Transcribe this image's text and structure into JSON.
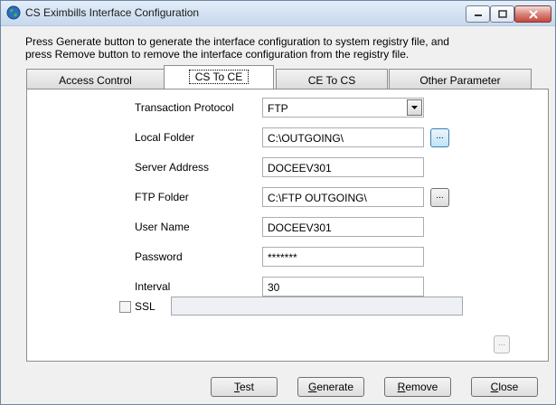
{
  "window": {
    "title": "CS Eximbills Interface Configuration",
    "icon": "globe-icon",
    "controls": [
      "minimize-icon",
      "maximize-icon",
      "close-icon"
    ]
  },
  "description": {
    "line1": "Press Generate button to generate the interface configuration to system registry file, and",
    "line2": "press Remove button to remove the interface configuration from the registry file."
  },
  "tabs": [
    {
      "label": "Access Control",
      "active": false
    },
    {
      "label": "CS To CE",
      "active": true
    },
    {
      "label": "CE To CS",
      "active": false
    },
    {
      "label": "Other Parameter",
      "active": false
    }
  ],
  "form": {
    "protocol_label": "Transaction Protocol",
    "protocol_value": "FTP",
    "local_folder_label": "Local Folder",
    "local_folder_value": "C:\\OUTGOING\\",
    "server_label": "Server Address",
    "server_value": "DOCEEV301",
    "ftp_folder_label": "FTP Folder",
    "ftp_folder_value": "C:\\FTP OUTGOING\\",
    "user_label": "User Name",
    "user_value": "DOCEEV301",
    "password_label": "Password",
    "password_value": "*******",
    "interval_label": "Interval",
    "interval_value": "30",
    "browse_label": "...",
    "ssl_label": "SSL",
    "ssl_checked": false,
    "ssl_value": ""
  },
  "buttons": {
    "test_first": "T",
    "test_rest": "est",
    "generate_first": "G",
    "generate_rest": "enerate",
    "remove_first": "R",
    "remove_rest": "emove",
    "close_first": "C",
    "close_rest": "lose"
  },
  "colors": {
    "titlebar": "#d2e1f2",
    "close_button": "#c7463c",
    "focus_button": "#bfe3fa"
  }
}
